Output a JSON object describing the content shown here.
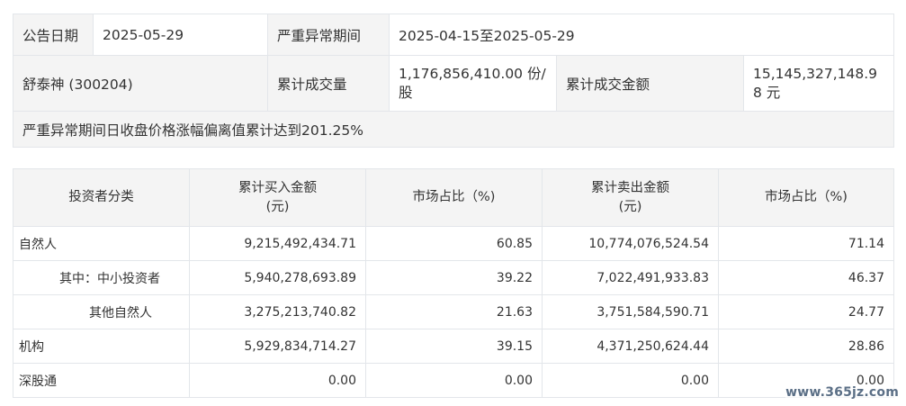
{
  "info": {
    "announce_date_label": "公告日期",
    "announce_date": "2025-05-29",
    "period_label": "严重异常期间",
    "period": "2025-04-15至2025-05-29",
    "stock": "舒泰神 (300204)",
    "volume_label": "累计成交量",
    "volume": "1,176,856,410.00 份/股",
    "amount_label": "累计成交金额",
    "amount": "15,145,327,148.98 元",
    "note": "严重异常期间日收盘价格涨幅偏离值累计达到201.25%"
  },
  "trade_table": {
    "headers": {
      "category": "投资者分类",
      "buy_amount": "累计买入金额\n(元)",
      "buy_share": "市场占比（%)",
      "sell_amount": "累计卖出金额\n(元)",
      "sell_share": "市场占比（%)"
    },
    "rows": [
      {
        "category": "自然人",
        "buy": "9,215,492,434.71",
        "buy_pct": "60.85",
        "sell": "10,774,076,524.54",
        "sell_pct": "71.14"
      },
      {
        "category": "其中：中小投资者",
        "buy": "5,940,278,693.89",
        "buy_pct": "39.22",
        "sell": "7,022,491,933.83",
        "sell_pct": "46.37"
      },
      {
        "category": "其他自然人",
        "buy": "3,275,213,740.82",
        "buy_pct": "21.63",
        "sell": "3,751,584,590.71",
        "sell_pct": "24.77"
      },
      {
        "category": "机构",
        "buy": "5,929,834,714.27",
        "buy_pct": "39.15",
        "sell": "4,371,250,624.44",
        "sell_pct": "28.86"
      },
      {
        "category": "深股通",
        "buy": "0.00",
        "buy_pct": "0.00",
        "sell": "0.00",
        "sell_pct": "0.00"
      }
    ]
  },
  "watermark": "www.365jz.com"
}
